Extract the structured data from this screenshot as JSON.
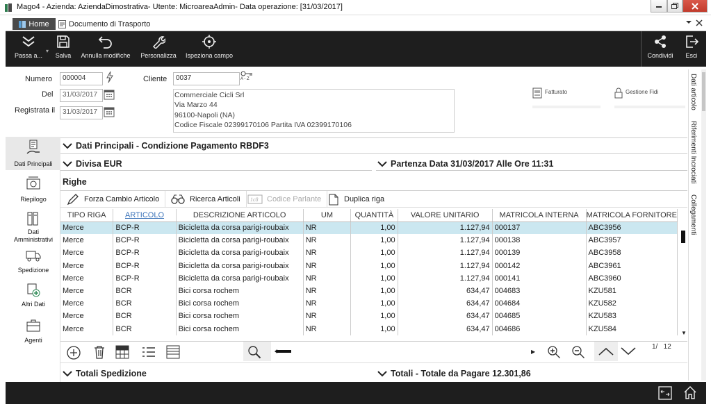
{
  "window": {
    "title": "Mago4 - Azienda: AziendaDimostrativa- Utente: MicroareaAdmin- Data operazione: [31/03/2017]"
  },
  "tabs": [
    {
      "label": "Home"
    },
    {
      "label": "Documento di Trasporto"
    }
  ],
  "toolbar": {
    "passa": "Passa a...",
    "salva": "Salva",
    "annulla": "Annulla modifiche",
    "personalizza": "Personalizza",
    "ispeziona": "Ispeziona campo",
    "condividi": "Condividi",
    "esci": "Esci"
  },
  "header": {
    "numero_label": "Numero",
    "numero": "000004",
    "del_label": "Del",
    "del": "31/03/2017",
    "registrata_label": "Registrata il",
    "registrata": "31/03/2017",
    "cliente_label": "Cliente",
    "cliente": "0037",
    "az": "A - Z",
    "address": [
      "Commerciale Cicli Srl",
      "Via Marzo 44",
      "96100-Napoli (NA)",
      "Codice Fiscale 02399170106 Partita IVA 02399170106"
    ],
    "fatturato": "Fatturato",
    "gestione_fidi": "Gestione Fidi"
  },
  "nav": {
    "dati_principali": "Dati Principali",
    "riepilogo": "Riepilogo",
    "dati_amministrativi_1": "Dati",
    "dati_amministrativi_2": "Amministrativi",
    "spedizione": "Spedizione",
    "altri_dati": "Altri Dati",
    "agenti": "Agenti"
  },
  "sections": {
    "dati_principali": "Dati Principali - Condizione Pagamento RBDF3",
    "divisa": "Divisa EUR",
    "partenza": "Partenza Data 31/03/2017 Alle Ore 11:31",
    "righe": "Righe",
    "totali_spedizione": "Totali Spedizione",
    "totali": "Totali - Totale da Pagare 12.301,86"
  },
  "grid_toolbar": {
    "forza": "Forza Cambio Articolo",
    "ricerca": "Ricerca Articoli",
    "codice": "Codice Parlante",
    "duplica": "Duplica riga"
  },
  "table": {
    "columns": [
      "TIPO RIGA",
      "ARTICOLO",
      "DESCRIZIONE ARTICOLO",
      "UM",
      "QUANTITÀ",
      "VALORE UNITARIO",
      "MATRICOLA INTERNA",
      "MATRICOLA FORNITORE"
    ],
    "rows": [
      [
        "Merce",
        "BCP-R",
        "Bicicletta da corsa parigi-roubaix",
        "NR",
        "1,00",
        "1.127,94",
        "000137",
        "ABC3956"
      ],
      [
        "Merce",
        "BCP-R",
        "Bicicletta da corsa parigi-roubaix",
        "NR",
        "1,00",
        "1.127,94",
        "000138",
        "ABC3957"
      ],
      [
        "Merce",
        "BCP-R",
        "Bicicletta da corsa parigi-roubaix",
        "NR",
        "1,00",
        "1.127,94",
        "000139",
        "ABC3958"
      ],
      [
        "Merce",
        "BCP-R",
        "Bicicletta da corsa parigi-roubaix",
        "NR",
        "1,00",
        "1.127,94",
        "000142",
        "ABC3961"
      ],
      [
        "Merce",
        "BCP-R",
        "Bicicletta da corsa parigi-roubaix",
        "NR",
        "1,00",
        "1.127,94",
        "000141",
        "ABC3960"
      ],
      [
        "Merce",
        "BCR",
        "Bici corsa rochem",
        "NR",
        "1,00",
        "634,47",
        "004683",
        "KZU581"
      ],
      [
        "Merce",
        "BCR",
        "Bici corsa rochem",
        "NR",
        "1,00",
        "634,47",
        "004684",
        "KZU582"
      ],
      [
        "Merce",
        "BCR",
        "Bici corsa rochem",
        "NR",
        "1,00",
        "634,47",
        "004685",
        "KZU583"
      ],
      [
        "Merce",
        "BCR",
        "Bici corsa rochem",
        "NR",
        "1,00",
        "634,47",
        "004686",
        "KZU584"
      ]
    ],
    "pager": "1/   12"
  },
  "right_tabs": {
    "dati_articolo": "Dati articolo",
    "riferimenti": "Riferimenti Incrociati",
    "collegamenti": "Collegamenti"
  },
  "colors": {
    "dark": "#1e1e1e",
    "selected_row": "#cbe7f0",
    "accent": "#3b73b9"
  }
}
